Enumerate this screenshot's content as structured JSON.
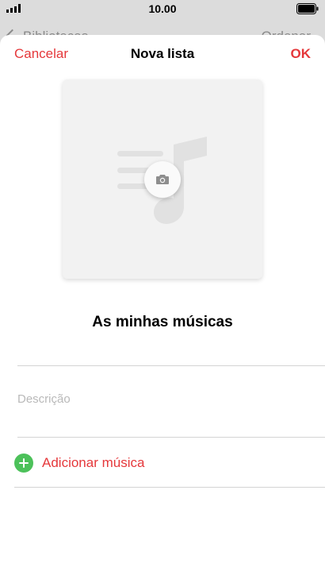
{
  "status_bar": {
    "time": "10.00"
  },
  "background_screen": {
    "back_label": "Bibliotecas",
    "right_label": "Ordenar"
  },
  "nav": {
    "cancel_label": "Cancelar",
    "title": "Nova lista",
    "ok_label": "OK"
  },
  "artwork": {
    "placeholder_icon": "music-note-icon",
    "camera_icon": "camera-icon"
  },
  "playlist": {
    "name": "As minhas músicas",
    "description_placeholder": "Descrição"
  },
  "actions": {
    "add_music_label": "Adicionar música",
    "add_icon": "plus-circle-icon"
  },
  "colors": {
    "accent": "#e5383b",
    "add_green": "#4cc15a"
  }
}
